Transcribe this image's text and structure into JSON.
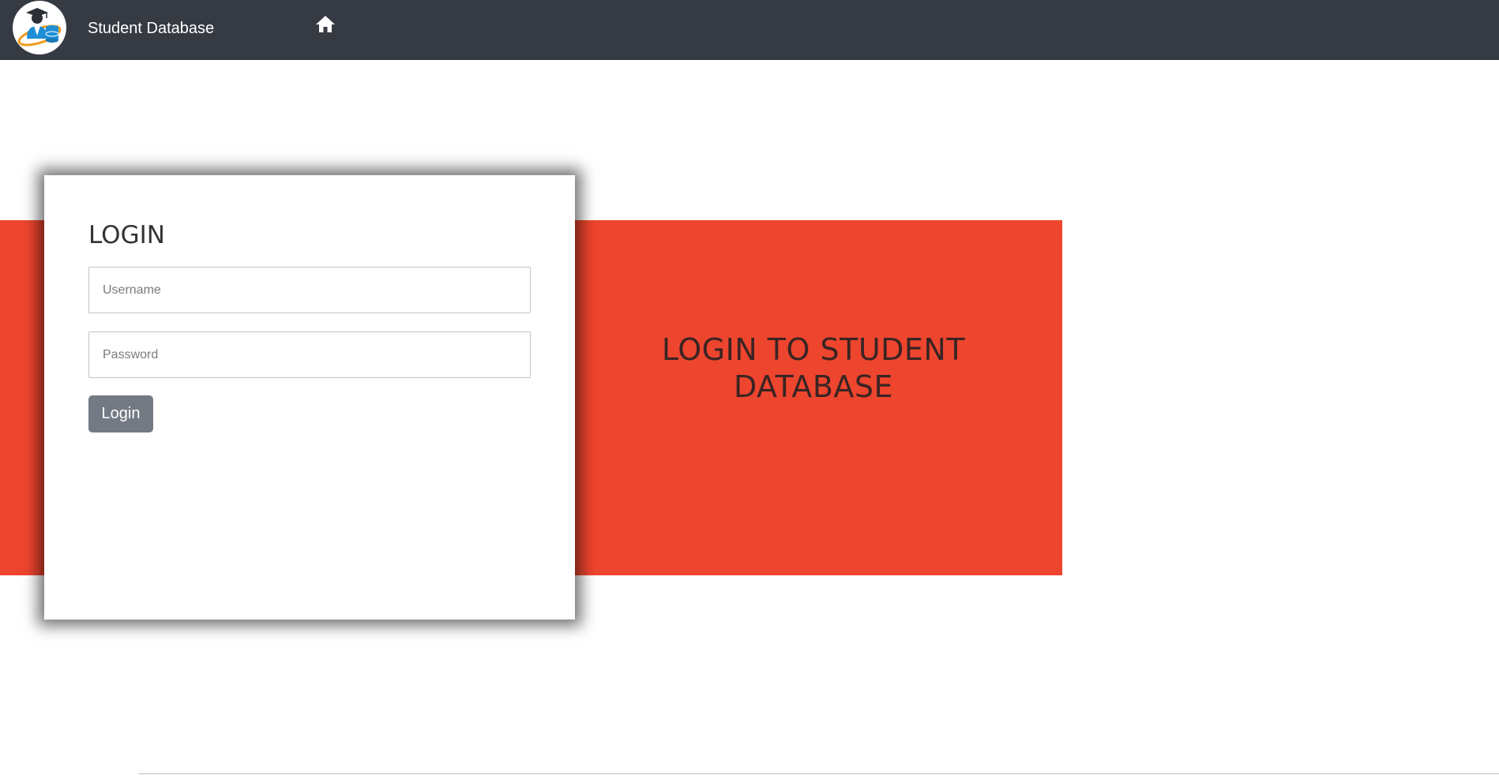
{
  "navbar": {
    "brand": "Student Database",
    "logo_icon": "student-database-logo",
    "home_icon": "home-icon",
    "background": "#353a43"
  },
  "hero": {
    "text": "LOGIN TO STUDENT DATABASE",
    "band_color": "#ee452e"
  },
  "login": {
    "title": "LOGIN",
    "username": {
      "placeholder": "Username",
      "value": ""
    },
    "password": {
      "placeholder": "Password",
      "value": ""
    },
    "submit_label": "Login",
    "button_color": "#737a83"
  }
}
